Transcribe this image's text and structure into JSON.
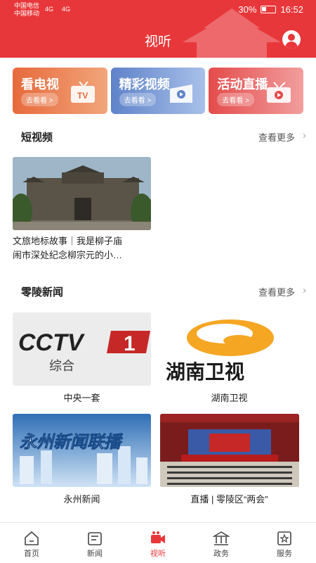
{
  "status_bar": {
    "carrier_1": "中国电信",
    "carrier_2": "中国移动",
    "signal_1": "4G",
    "signal_2": "4G",
    "battery": "30%",
    "time": "16:52"
  },
  "header": {
    "title": "视听"
  },
  "category_cards": [
    {
      "title": "看电视",
      "sub": "去看看 >",
      "color": "#e66a3c"
    },
    {
      "title": "精彩视频",
      "sub": "去看看 >",
      "color": "#5f83c9"
    },
    {
      "title": "活动直播",
      "sub": "去看看 >",
      "color": "#e44b4b"
    }
  ],
  "short_video": {
    "title": "短视频",
    "more": "查看更多",
    "items": [
      {
        "caption_line1": "文旅地标故事｜我是柳子庙",
        "caption_line2": "闹市深处纪念柳宗元的小…"
      }
    ]
  },
  "lingling_news": {
    "title": "零陵新闻",
    "more": "查看更多",
    "items": [
      {
        "caption": "中央一套",
        "logo_text": "CCTV",
        "logo_num": "1",
        "logo_sub": "综合"
      },
      {
        "caption": "湖南卫视",
        "logo_text": "湖南卫视"
      },
      {
        "caption": "永州新闻",
        "logo_text": "永州新闻联播"
      },
      {
        "caption": "直播 | 零陵区“两会”"
      }
    ]
  },
  "bottom_nav": [
    {
      "label": "首页",
      "icon": "home-icon"
    },
    {
      "label": "新闻",
      "icon": "news-icon"
    },
    {
      "label": "视听",
      "icon": "video-camera-icon",
      "active": true
    },
    {
      "label": "政务",
      "icon": "government-icon"
    },
    {
      "label": "服务",
      "icon": "service-icon"
    }
  ],
  "colors": {
    "brand_red": "#e8373a"
  }
}
